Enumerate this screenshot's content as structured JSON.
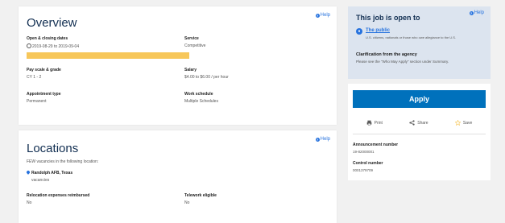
{
  "overview": {
    "title": "Overview",
    "help": "Help",
    "dates_label": "Open & closing dates",
    "dates_value": "2019-08-29 to 2019-09-04",
    "service_label": "Service",
    "service_value": "Competitive",
    "pay_label": "Pay scale & grade",
    "pay_value": "CY 1 - 2",
    "salary_label": "Salary",
    "salary_value": "$4.00 to $6.00 / per hour",
    "appt_label": "Appointment type",
    "appt_value": "Permanent",
    "schedule_label": "Work schedule",
    "schedule_value": "Multiple Schedules",
    "highlight_color": "#f7c75a"
  },
  "locations": {
    "title": "Locations",
    "help": "Help",
    "intro": "FEW vacancies in the following location:",
    "location_name": "Randolph AFB, Texas",
    "location_sub": "vacancies",
    "relocation_label": "Relocation expenses reimbursed",
    "relocation_value": "No",
    "telework_label": "Telework eligible",
    "telework_value": "No"
  },
  "open_to": {
    "title": "This job is open to",
    "help": "Help",
    "audience_link": "The public",
    "audience_desc": "U.S. citizens, nationals or those who owe allegiance to the U.S.",
    "clar_title": "Clarification from the agency",
    "clar_text": "Please see the \"Who May Apply\" section under Summary.",
    "bg_color": "#dce4ef"
  },
  "actions": {
    "apply_label": "Apply",
    "print_label": "Print",
    "share_label": "Share",
    "save_label": "Save",
    "announcement_label": "Announcement number",
    "announcement_value": "19-82000001",
    "control_label": "Control number",
    "control_value": "0001379709",
    "apply_color": "#0071bc"
  }
}
